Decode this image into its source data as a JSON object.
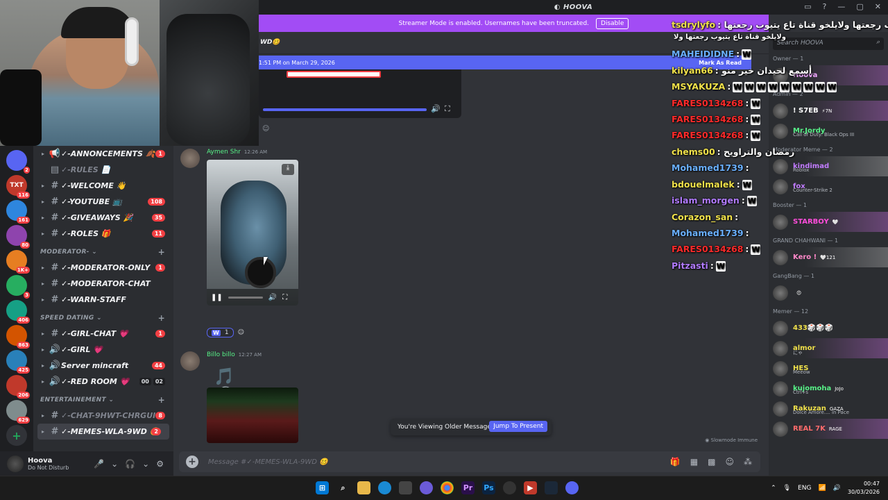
{
  "app": {
    "title": "HOOVA",
    "window_controls": [
      "▭",
      "?",
      "—",
      "▢",
      "✕"
    ]
  },
  "streamer_banner": {
    "text": "Streamer Mode is enabled. Usernames have been truncated.",
    "disable": "Disable"
  },
  "channel_header": {
    "name": "WD🥴"
  },
  "new_banner": {
    "text": "1:51 PM on March 29, 2026",
    "mark_read": "Mark As Read"
  },
  "servers": [
    {
      "label": "",
      "badge": "2",
      "color": "#5865f2"
    },
    {
      "label": "TXT",
      "badge": "116",
      "color": "#c0392b"
    },
    {
      "label": "",
      "badge": "161",
      "color": "#2e86de"
    },
    {
      "label": "",
      "badge": "80",
      "color": "#8e44ad"
    },
    {
      "label": "",
      "badge": "1K+",
      "color": "#e67e22"
    },
    {
      "label": "",
      "badge": "3",
      "color": "#27ae60"
    },
    {
      "label": "",
      "badge": "406",
      "color": "#16a085"
    },
    {
      "label": "",
      "badge": "863",
      "color": "#d35400"
    },
    {
      "label": "",
      "badge": "425",
      "color": "#2980b9"
    },
    {
      "label": "",
      "badge": "206",
      "color": "#c0392b"
    },
    {
      "label": "",
      "badge": "629",
      "color": "#7f8c8d"
    }
  ],
  "channels": {
    "items": [
      {
        "icon": "📢",
        "name": "✓-ANNONCEMENTS 🍂",
        "count": "1",
        "muted": false,
        "caret": true
      },
      {
        "icon": "▤",
        "name": "✓-RULES 📄",
        "count": "",
        "muted": true,
        "caret": false
      },
      {
        "icon": "#",
        "name": "✓-WELCOME 👋",
        "count": "",
        "muted": false,
        "caret": true
      },
      {
        "icon": "#",
        "name": "✓-YOUTUBE 📺",
        "count": "108",
        "muted": false,
        "caret": true
      },
      {
        "icon": "#",
        "name": "✓-GIVEAWAYS 🎉",
        "count": "35",
        "muted": false,
        "caret": true
      },
      {
        "icon": "#",
        "name": "✓-ROLES 🎁",
        "count": "11",
        "muted": false,
        "caret": true
      }
    ],
    "cat_moderator": "MODERATOR-",
    "moderator_items": [
      {
        "icon": "#",
        "name": "✓-MODERATOR-ONLY",
        "count": "1"
      },
      {
        "icon": "#",
        "name": "✓-MODERATOR-CHAT",
        "count": ""
      },
      {
        "icon": "#",
        "name": "✓-WARN-STAFF",
        "count": ""
      }
    ],
    "cat_speed": "SPEED DATING",
    "speed_items": [
      {
        "icon": "#",
        "name": "✓-GIRL-CHAT 💗",
        "count": "1"
      },
      {
        "icon": "🔊",
        "name": "✓-GIRL 💗",
        "count": ""
      },
      {
        "icon": "🔊",
        "name": "Server mincraft",
        "count": "44"
      },
      {
        "icon": "🔊",
        "name": "✓-RED ROOM 💗",
        "count": ""
      }
    ],
    "red_room_counts": [
      "00",
      "02"
    ],
    "cat_entertainment": "ENTERTAINEMENT",
    "ent_items": [
      {
        "icon": "#",
        "name": "✓-CHAT-9HWT-CHRGUI",
        "count": "8",
        "muted": true
      },
      {
        "icon": "#",
        "name": "✓-MEMES-WLA-9WD 🥴",
        "count": "2",
        "muted": false
      }
    ]
  },
  "user": {
    "name": "Hoova",
    "status": "Do Not Disturb",
    "icons": [
      "🎤",
      "⌄",
      "🎧",
      "⌄",
      "⚙"
    ]
  },
  "messages": [
    {
      "author": "Aymen Shr",
      "time": "12:26 AM",
      "reaction_count": "1"
    },
    {
      "author": "Billo billo",
      "time": "12:27 AM"
    }
  ],
  "older_bar": {
    "text": "You're Viewing Older Messages",
    "jump": "Jump To Present"
  },
  "slowmode": "Slowmode Immune",
  "composer": {
    "placeholder": "Message #✓-MEMES-WLA-9WD 🥴",
    "tools": [
      "🎁",
      "▦",
      "▩",
      "☺",
      "⁂"
    ]
  },
  "twitch_chat": [
    {
      "user": "tsdrylyfo",
      "color": "#f0e14a",
      "text": ": يلكو قناة تاع يتيوب رجعتها ولايلخو قناة تاع يتيوب رجعتها",
      "w": 0
    },
    {
      "user": "",
      "color": "#ffffff",
      "text": "ولايلخو قناة تاع يتيوب رجعتها ولا",
      "w": 0
    },
    {
      "user": "MAHEIDIDNE",
      "color": "#6ab0ff",
      "text": ":",
      "w": 1
    },
    {
      "user": "kilyan66",
      "color": "#f0e14a",
      "text": ": أسمع لحيدان خير منو",
      "w": 0
    },
    {
      "user": "MSYAKUZA",
      "color": "#f0e14a",
      "text": ":",
      "w": 9
    },
    {
      "user": "FARES0134z68",
      "color": "#ff2a2a",
      "text": ":",
      "w": 1
    },
    {
      "user": "FARES0134z68",
      "color": "#ff2a2a",
      "text": ":",
      "w": 1
    },
    {
      "user": "FARES0134z68",
      "color": "#ff2a2a",
      "text": ":",
      "w": 1
    },
    {
      "user": "chems00",
      "color": "#f0e14a",
      "text": ": رمضان والتراويح",
      "w": 0
    },
    {
      "user": "Mohamed1739",
      "color": "#6ab0ff",
      "text": ":",
      "w": 0
    },
    {
      "user": "bdouelmalek",
      "color": "#f0e14a",
      "text": ":",
      "w": 1
    },
    {
      "user": "islam_morgen",
      "color": "#b17bff",
      "text": ":",
      "w": 1
    },
    {
      "user": "Corazon_san",
      "color": "#f0e14a",
      "text": ":",
      "w": 0
    },
    {
      "user": "Mohamed1739",
      "color": "#6ab0ff",
      "text": ":",
      "w": 0
    },
    {
      "user": "FARES0134z68",
      "color": "#ff2a2a",
      "text": ":",
      "w": 1
    },
    {
      "user": "Pitzasti",
      "color": "#b17bff",
      "text": ":",
      "w": 1
    }
  ],
  "members": {
    "search_placeholder": "Search HOOVA",
    "groups": [
      {
        "title": "Owner — 1",
        "list": [
          {
            "name": "Hoova",
            "sub": "",
            "color": "#f0a6ff",
            "style": "hl"
          }
        ]
      },
      {
        "title": "Admin — 2",
        "list": [
          {
            "name": "! S7EB",
            "sub": "",
            "color": "#ffffff",
            "style": "hl",
            "badge": "⚡7N"
          },
          {
            "name": "Mr.Jordy",
            "sub": "Call of Duty: Black Ops III",
            "color": "#57f287",
            "style": ""
          }
        ]
      },
      {
        "title": "Moderator Meme — 2",
        "list": [
          {
            "name": "kindimad",
            "sub": "Roblox",
            "color": "#c27cff",
            "style": "gr"
          },
          {
            "name": "fox",
            "sub": "Counter-Strike 2",
            "color": "#c27cff",
            "style": ""
          }
        ]
      },
      {
        "title": "Booster — 1",
        "list": [
          {
            "name": "STARBOY",
            "sub": "",
            "color": "#ff4ddb",
            "style": "hl",
            "badge": "🤍"
          }
        ]
      },
      {
        "title": "GRAND CHAHWANI — 1",
        "list": [
          {
            "name": "Kero !",
            "sub": "",
            "color": "#ff88c9",
            "style": "gr",
            "badge": "🤍121"
          }
        ]
      },
      {
        "title": "GangBang — 1",
        "list": [
          {
            "name": "",
            "sub": "",
            "color": "#ff4444",
            "style": "",
            "badge": "😍"
          }
        ]
      },
      {
        "title": "Memer — 12",
        "list": [
          {
            "name": "433🎲🎲🎲",
            "sub": "",
            "color": "#f0e14a",
            "style": ""
          },
          {
            "name": "almor",
            "sub": "にゃ",
            "color": "#f0e14a",
            "style": "hl"
          },
          {
            "name": "HES",
            "sub": "Meeow",
            "color": "#f0e14a",
            "style": ""
          },
          {
            "name": "kujomoha",
            "sub": "Ctrl+s",
            "color": "#57f287",
            "style": "",
            "badge": "JoJo"
          },
          {
            "name": "Rakuzan",
            "sub": "Dolce Amore.... in Pace",
            "color": "#f0e14a",
            "style": "",
            "badge": "GAZA"
          },
          {
            "name": "REAL 7K",
            "sub": "",
            "color": "#ff6b6b",
            "style": "hl",
            "badge": "RAGE"
          }
        ]
      }
    ]
  },
  "taskbar": {
    "lang": "ENG",
    "time": "00:47",
    "date": "30/03/2026"
  }
}
